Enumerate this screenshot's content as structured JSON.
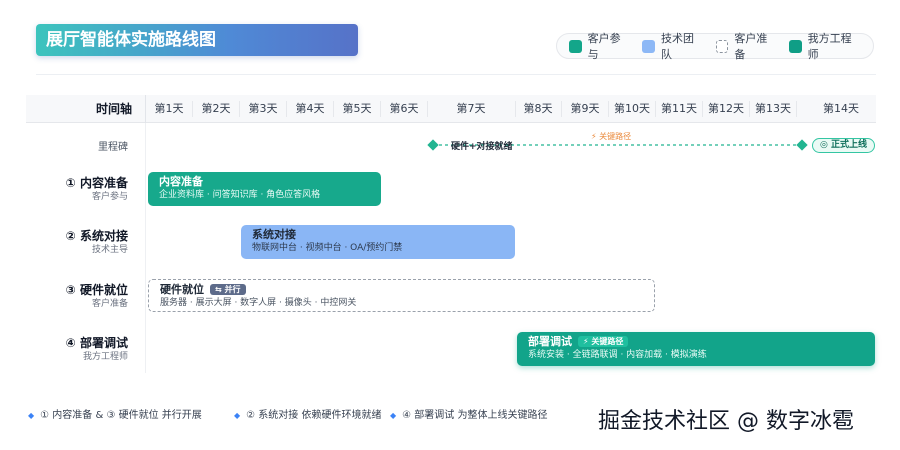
{
  "title": "展厅智能体实施路线图",
  "legend": [
    {
      "label": "客户参与",
      "color": "#13a68a"
    },
    {
      "label": "技术团队",
      "color": "#8db8f6"
    },
    {
      "label": "客户准备",
      "color": "dashed"
    },
    {
      "label": "我方工程师",
      "color": "#0f9e86"
    }
  ],
  "axis": {
    "label": "时间轴",
    "days": [
      "第1天",
      "第2天",
      "第3天",
      "第4天",
      "第5天",
      "第6天",
      "第7天",
      "第8天",
      "第9天",
      "第10天",
      "第11天",
      "第12天",
      "第13天",
      "第14天"
    ]
  },
  "milestones": {
    "label": "里程碑",
    "start_label": "硬件+对接就绪",
    "critical_label": "⚡ 关键路径",
    "launch_label": "◎ 正式上线"
  },
  "rows": [
    {
      "title": "① 内容准备",
      "sub": "客户参与",
      "bar_title": "内容准备",
      "bar_desc": "企业资料库 · 问答知识库 · 角色应答风格"
    },
    {
      "title": "② 系统对接",
      "sub": "技术主导",
      "bar_title": "系统对接",
      "bar_desc": "物联网中台 · 视频中台 · OA/预约门禁"
    },
    {
      "title": "③ 硬件就位",
      "sub": "客户准备",
      "bar_title": "硬件就位",
      "bar_tag": "⇆ 并行",
      "bar_desc": "服务器 · 展示大屏 · 数字人屏 · 摄像头 · 中控网关"
    },
    {
      "title": "④ 部署调试",
      "sub": "我方工程师",
      "bar_title": "部署调试",
      "bar_tag": "⚡ 关键路径",
      "bar_desc": "系统安装 · 全链路联调 · 内容加载 · 模拟演练"
    }
  ],
  "notes": [
    "① 内容准备 & ③ 硬件就位 并行开展",
    "② 系统对接 依赖硬件环境就绪",
    "④ 部署调试 为整体上线关键路径"
  ],
  "watermark": "掘金技术社区 @ 数字冰雹"
}
